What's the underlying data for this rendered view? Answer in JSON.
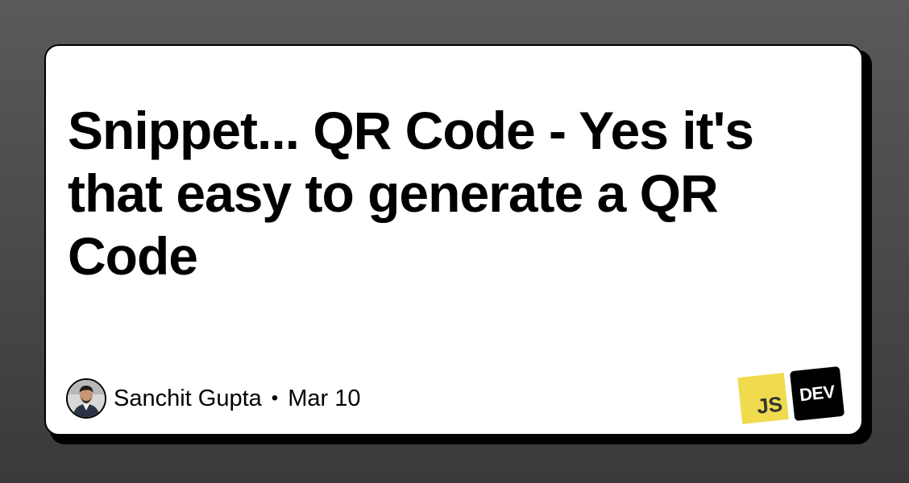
{
  "post": {
    "title": "Snippet... QR Code - Yes it's that easy to generate a QR Code",
    "author": "Sanchit Gupta",
    "separator": "•",
    "date": "Mar 10"
  },
  "logos": {
    "js": "JS",
    "dev": "DEV"
  },
  "colors": {
    "background": "#4a4a4a",
    "card": "#ffffff",
    "card_border": "#000000",
    "js_yellow": "#f0db4f",
    "dev_black": "#000000"
  },
  "icons": {
    "avatar": "author-avatar-photo",
    "js": "javascript-logo",
    "dev": "dev-community-logo"
  }
}
